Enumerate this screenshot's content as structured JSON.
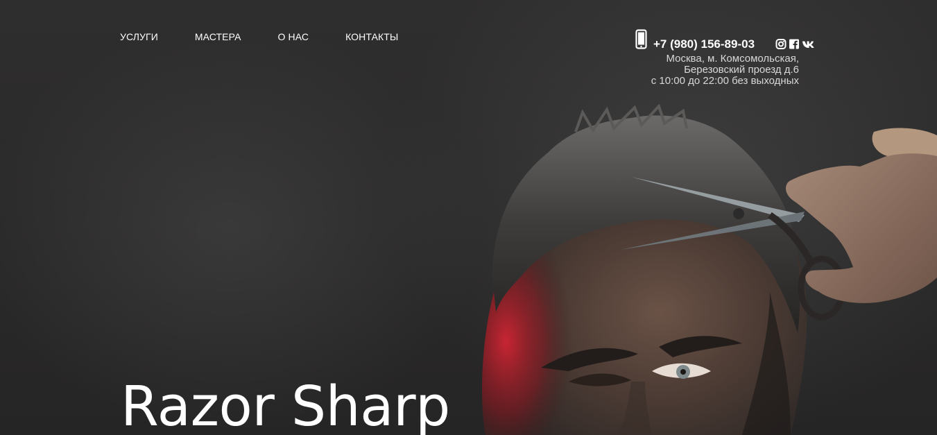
{
  "nav": {
    "items": [
      {
        "label": "УСЛУГИ"
      },
      {
        "label": "МАСТЕРА"
      },
      {
        "label": "О НАС"
      },
      {
        "label": "КОНТАКТЫ"
      }
    ]
  },
  "contact": {
    "phone": "+7 (980) 156-89-03",
    "phone_icon": "smartphone-icon",
    "socials": [
      "instagram-icon",
      "facebook-icon",
      "vk-icon"
    ],
    "address_line1": "Москва, м. Комсомольская,",
    "address_line2": "Березовский проезд д.6",
    "hours": "с 10:00 до 22:00 без выходных"
  },
  "hero": {
    "title": "Razor Sharp"
  },
  "colors": {
    "background": "#2d2c2c",
    "text": "#ffffff",
    "accent_red": "#c41e2b"
  }
}
